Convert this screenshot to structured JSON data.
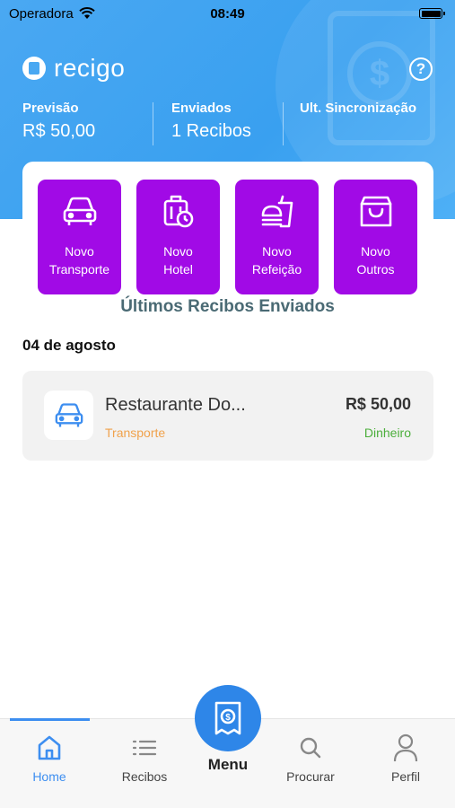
{
  "status_bar": {
    "carrier": "Operadora",
    "time": "08:49"
  },
  "app": {
    "name": "recigo"
  },
  "stats": [
    {
      "label": "Previsão",
      "value": "R$ 50,00"
    },
    {
      "label": "Enviados",
      "value": "1 Recibos"
    },
    {
      "label": "Ult. Sincronização",
      "value": ""
    }
  ],
  "categories": [
    {
      "icon": "car-icon",
      "line1": "Novo",
      "line2": "Transporte"
    },
    {
      "icon": "luggage-clock-icon",
      "line1": "Novo",
      "line2": "Hotel"
    },
    {
      "icon": "fastfood-icon",
      "line1": "Novo",
      "line2": "Refeição"
    },
    {
      "icon": "bag-icon",
      "line1": "Novo",
      "line2": "Outros"
    }
  ],
  "section_title": "Últimos Recibos Enviados",
  "date_group": "04 de agosto",
  "receipts": [
    {
      "icon": "car-icon",
      "name": "Restaurante Do...",
      "category": "Transporte",
      "value": "R$ 50,00",
      "payment": "Dinheiro"
    }
  ],
  "tabs": [
    {
      "label": "Home",
      "icon": "home-icon",
      "active": true
    },
    {
      "label": "Recibos",
      "icon": "list-icon"
    },
    {
      "label": "Menu",
      "icon": "receipt-dollar-icon"
    },
    {
      "label": "Procurar",
      "icon": "search-icon"
    },
    {
      "label": "Perfil",
      "icon": "user-icon"
    }
  ],
  "colors": {
    "header": "#4aa8f2",
    "category_button": "#a10ae6",
    "accent": "#3d8ef0",
    "category_text": "#f0a24c",
    "payment_text": "#4caf3c"
  }
}
